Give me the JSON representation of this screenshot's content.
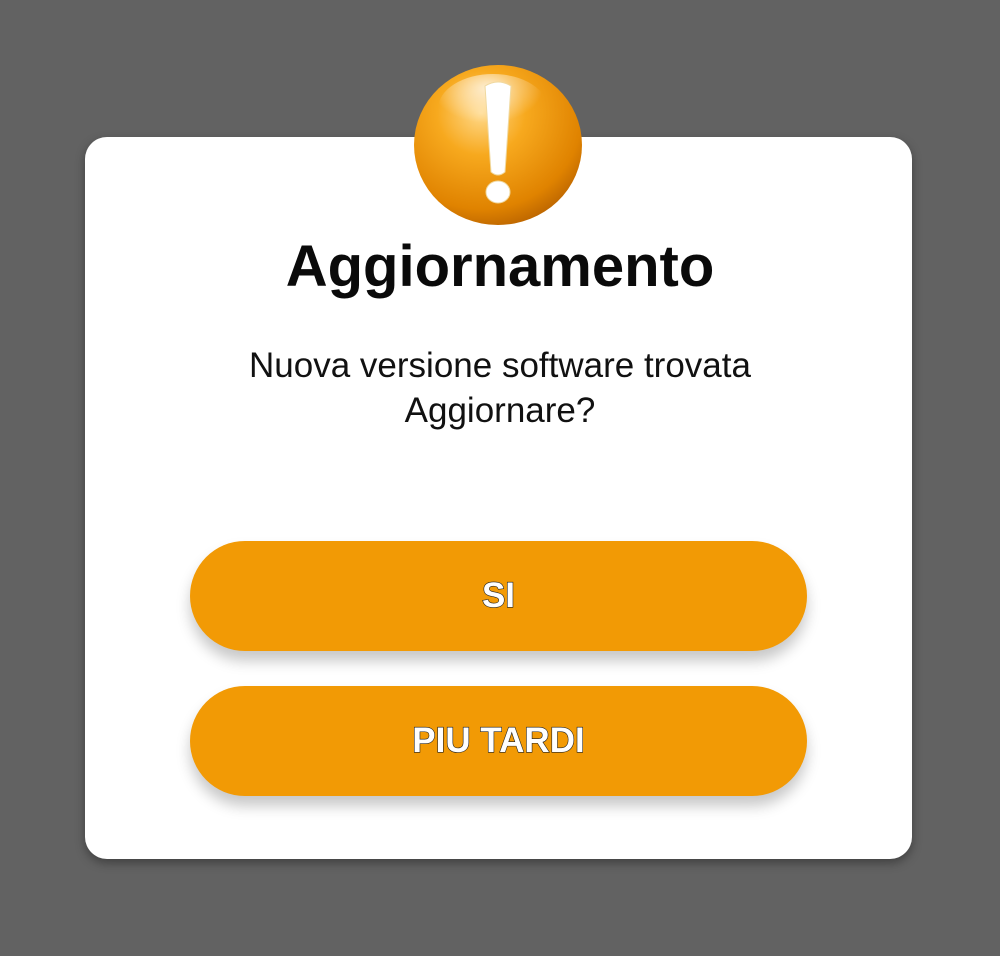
{
  "dialog": {
    "icon": "exclamation-warning-icon",
    "title": "Aggiornamento",
    "message_lines": [
      "Nuova versione software trovata",
      "Aggiornare?"
    ],
    "buttons": {
      "yes_label": "SI",
      "later_label": "PIU TARDI"
    }
  },
  "colors": {
    "backdrop": "#626262",
    "dialog_background": "#ffffff",
    "accent": "#f29a05",
    "button_text": "#ffffff"
  }
}
